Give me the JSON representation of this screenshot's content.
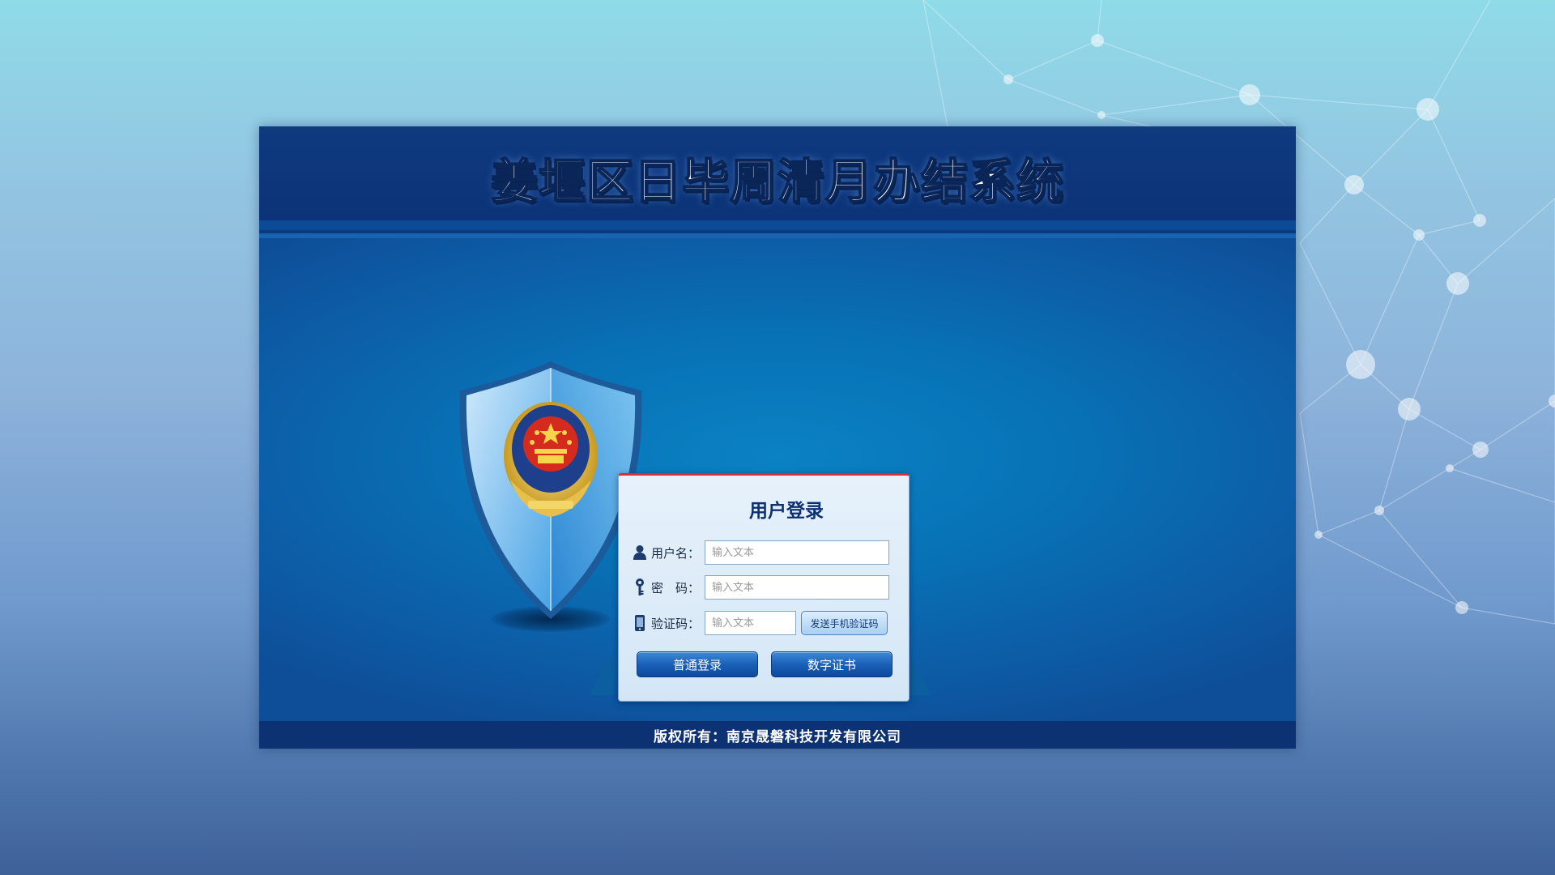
{
  "page": {
    "title": "姜堰区日毕周清月办结系统",
    "copyright": "版权所有：南京晟磐科技开发有限公司"
  },
  "login": {
    "title": "用户登录",
    "username_label": "用户名：",
    "username_placeholder": "输入文本",
    "password_label": "密　码：",
    "password_placeholder": "输入文本",
    "code_label": "验证码：",
    "code_placeholder": "输入文本",
    "sms_button": "发送手机验证码",
    "normal_login_button": "普通登录",
    "cert_login_button": "数字证书"
  },
  "icons": {
    "emblem": "police-shield-emblem-icon",
    "user": "user-icon",
    "key": "key-icon",
    "phone": "phone-icon"
  },
  "colors": {
    "header": "#0c3377",
    "panel": "#0872b6",
    "accent_red": "#d4302c",
    "button": "#1a60b8",
    "title_text": "#0d2f73"
  }
}
